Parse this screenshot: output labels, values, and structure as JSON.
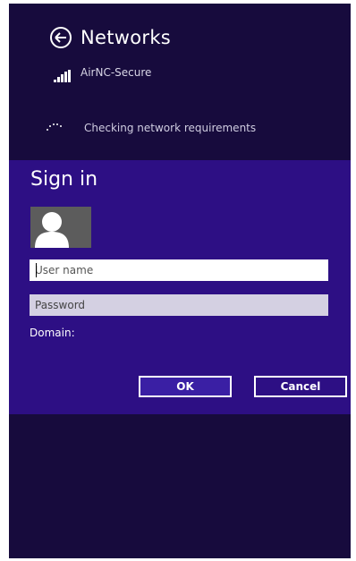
{
  "networks": {
    "title": "Networks",
    "network_name": "AirNC-Secure",
    "status_text": "Checking network requirements"
  },
  "signin": {
    "title": "Sign in",
    "username_placeholder": "User name",
    "password_placeholder": "Password",
    "domain_label": "Domain:",
    "ok_label": "OK",
    "cancel_label": "Cancel"
  },
  "icons": {
    "back": "back-arrow-circle-icon",
    "signal": "wifi-signal-icon",
    "spinner": "loading-dots-icon",
    "avatar": "user-avatar-icon"
  },
  "colors": {
    "background": "#170b3d",
    "dialog": "#2d0f84",
    "ok_button": "#3a1fa4",
    "password_field": "#d4d0e2"
  }
}
